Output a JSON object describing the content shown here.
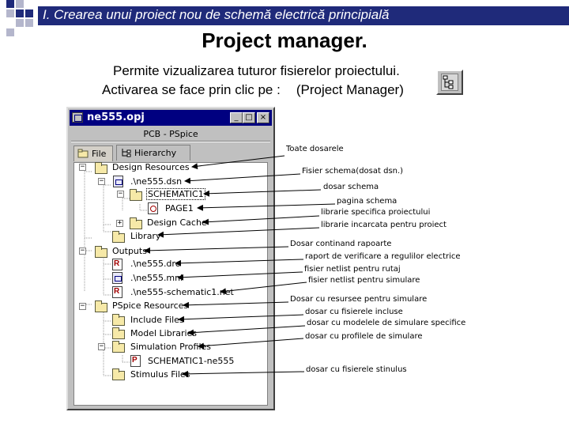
{
  "slide": {
    "title": "I. Crearea unui proiect nou de schemă electrică principială",
    "heading": "Project manager.",
    "description_line1": "Permite vizualizarea tuturor fisierelor proiectului.",
    "description_line2": "Activarea se face prin clic pe :",
    "description_pm": "(Project Manager)",
    "colors": {
      "title_bar": "#1f2a7a",
      "deco_gray": "#b4b6cc"
    }
  },
  "window": {
    "title": "ne555.opj",
    "buttons": [
      "_",
      "□",
      "×"
    ],
    "subtitle": "PCB - PSpice",
    "tabs": [
      "File",
      "Hierarchy"
    ],
    "tree": [
      {
        "label": "Design Resources",
        "icon": "folder-icon",
        "expander": "−"
      },
      {
        "label": ".\\ne555.dsn",
        "icon": "schematic-file-icon",
        "expander": "−"
      },
      {
        "label": "SCHEMATIC1",
        "icon": "folder-icon",
        "expander": "−"
      },
      {
        "label": "PAGE1",
        "icon": "page-icon",
        "expander": ""
      },
      {
        "label": "Design Cache",
        "icon": "folder-icon",
        "expander": "+"
      },
      {
        "label": "Library",
        "icon": "folder-icon",
        "expander": ""
      },
      {
        "label": "Outputs",
        "icon": "folder-icon",
        "expander": "−"
      },
      {
        "label": ".\\ne555.drc",
        "icon": "report-file-icon",
        "expander": ""
      },
      {
        "label": ".\\ne555.mnl",
        "icon": "netlist-file-icon",
        "expander": ""
      },
      {
        "label": ".\\ne555-schematic1.net",
        "icon": "report-file-icon",
        "expander": ""
      },
      {
        "label": "PSpice Resources",
        "icon": "folder-icon",
        "expander": "−"
      },
      {
        "label": "Include Files",
        "icon": "folder-icon",
        "expander": ""
      },
      {
        "label": "Model Libraries",
        "icon": "folder-icon",
        "expander": ""
      },
      {
        "label": "Simulation Profiles",
        "icon": "folder-icon",
        "expander": "−"
      },
      {
        "label": "SCHEMATIC1-ne555",
        "icon": "profile-file-icon",
        "expander": ""
      },
      {
        "label": "Stimulus Files",
        "icon": "folder-icon",
        "expander": ""
      }
    ]
  },
  "annotations": [
    "Toate dosarele",
    "Fisier schema(dosat dsn.)",
    "dosar schema",
    "pagina schema",
    "librarie specifica proiectului",
    "librarie incarcata pentru proiect",
    "Dosar continand rapoarte",
    "raport de verificare a regulilor electrice",
    "fisier netlist pentru rutaj",
    "fisier netlist pentru simulare",
    "Dosar cu resursee pentru simulare",
    "dosar cu fisierele incluse",
    "dosar cu modelele de simulare specifice",
    "dosar cu profilele de simulare",
    "dosar cu fisierele stinulus"
  ]
}
